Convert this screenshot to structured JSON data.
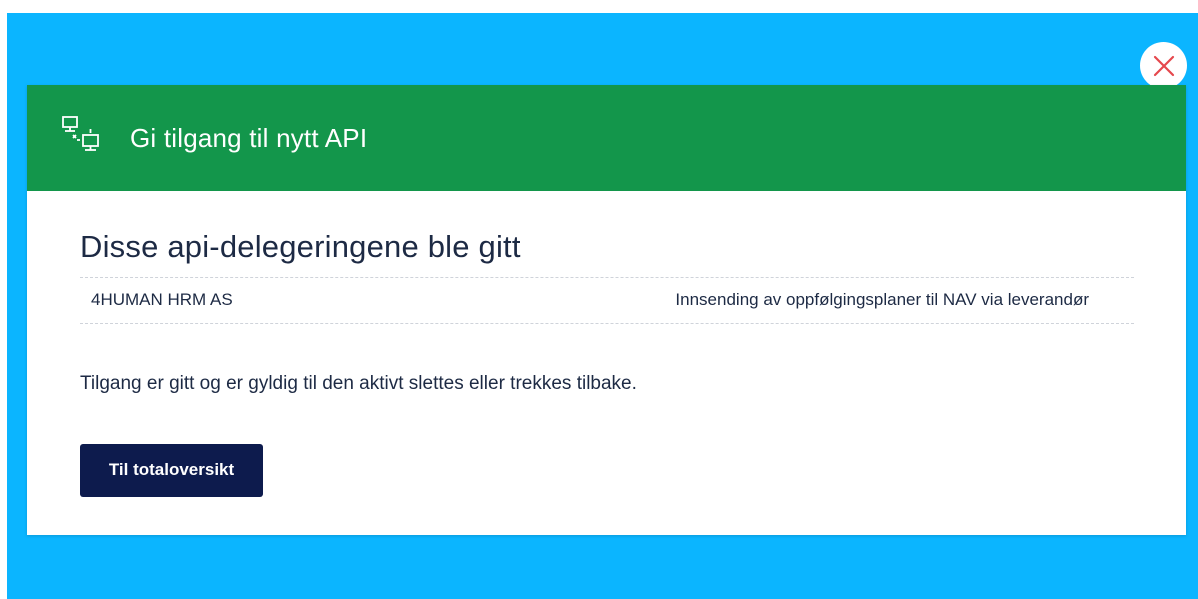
{
  "modal": {
    "title": "Gi tilgang til nytt API",
    "header_icon": "network-computers-icon",
    "close_icon": "close-icon",
    "close_icon_color": "#e5484d"
  },
  "body": {
    "heading": "Disse api-delegeringene ble gitt",
    "delegations": [
      {
        "organization": "4HUMAN HRM AS",
        "api_name": "Innsending av oppfølgingsplaner til NAV via leverandør"
      }
    ],
    "info_text": "Tilgang er gitt og er gyldig til den aktivt slettes eller trekkes tilbake.",
    "button_label": "Til totaloversikt"
  },
  "colors": {
    "backdrop": "#0bb5ff",
    "header": "#13964b",
    "primary_button": "#0d1b4d",
    "text": "#1d2a44"
  }
}
